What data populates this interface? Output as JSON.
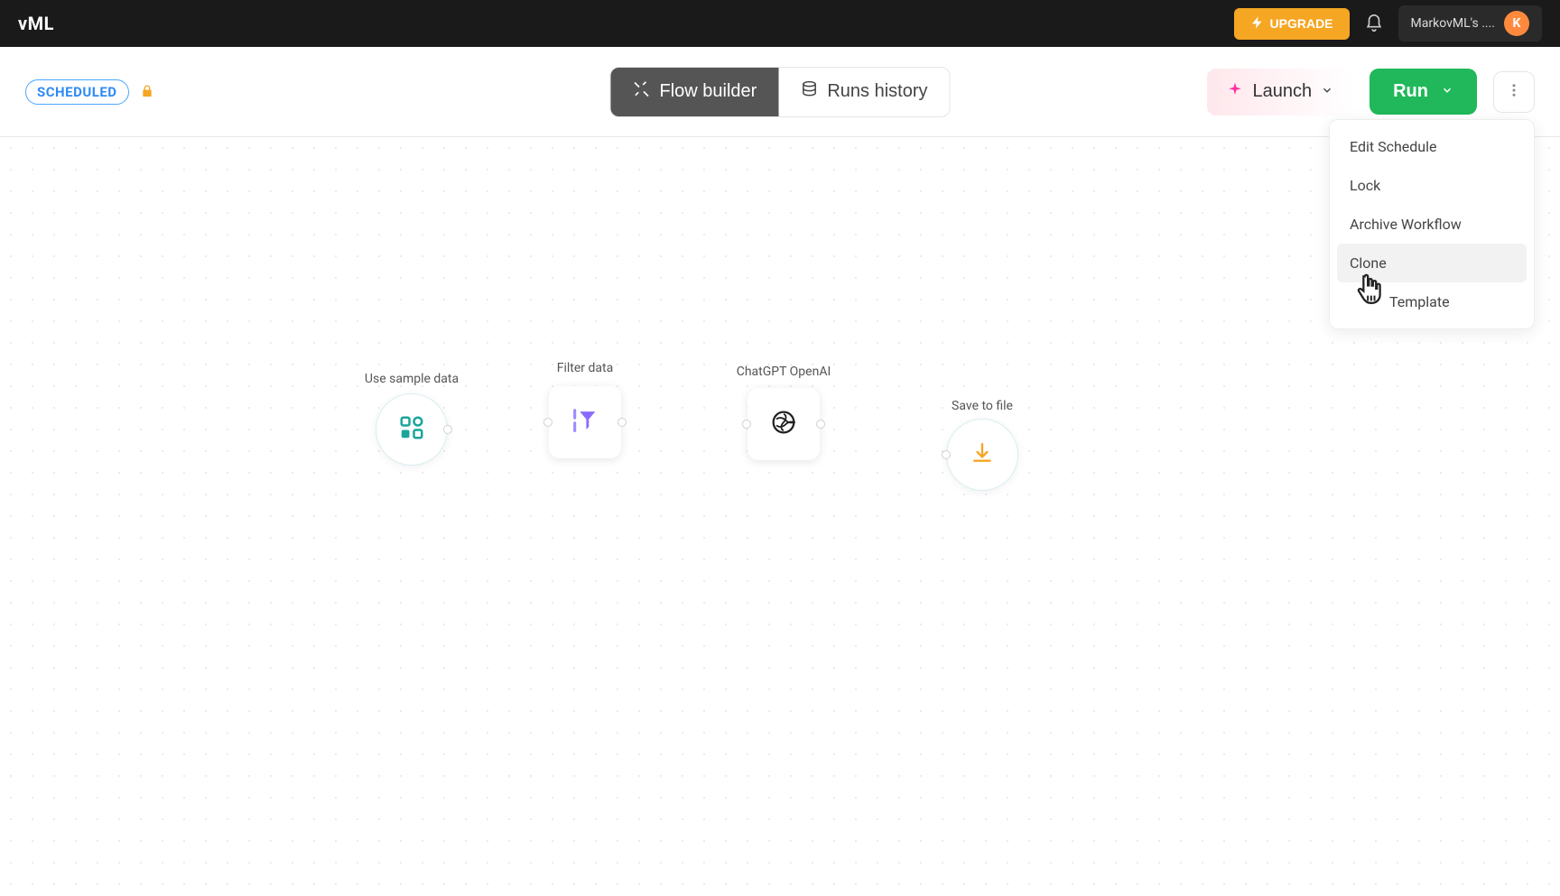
{
  "topbar": {
    "logo_suffix": "vML",
    "upgrade_label": "UPGRADE",
    "workspace_name": "MarkovML's ....",
    "avatar_initial": "K"
  },
  "toolbar": {
    "scheduled_pill": "SCHEDULED",
    "tabs": {
      "flow_builder": "Flow builder",
      "runs_history": "Runs history"
    },
    "launch_label": "Launch",
    "run_label": "Run"
  },
  "dropdown": {
    "items": [
      "Edit Schedule",
      "Lock",
      "Archive Workflow",
      "Clone",
      "Template"
    ],
    "highlight_index": 3
  },
  "canvas": {
    "nodes": [
      {
        "id": "n1",
        "label": "Use sample data"
      },
      {
        "id": "n2",
        "label": "Filter data"
      },
      {
        "id": "n3",
        "label": "ChatGPT OpenAI"
      },
      {
        "id": "n4",
        "label": "Save to file"
      }
    ]
  }
}
